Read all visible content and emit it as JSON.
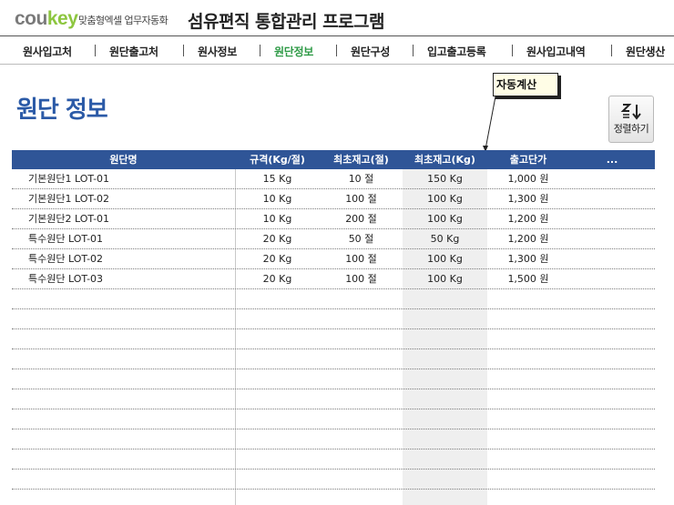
{
  "header": {
    "logo_gray": "cou",
    "logo_green": "key",
    "logo_sub": "맞춤형엑셀 업무자동화",
    "app_title": "섬유편직 통합관리 프로그램"
  },
  "nav": {
    "items": [
      "원사입고처",
      "원단출고처",
      "원사정보",
      "원단정보",
      "원단구성",
      "입고출고등록",
      "원사입고내역",
      "원단생산"
    ],
    "active_index": 3
  },
  "page": {
    "title": "원단 정보",
    "callout": "자동계산",
    "sort_button": "정렬하기"
  },
  "table": {
    "headers": [
      "원단명",
      "규격(Kg/절)",
      "최초재고(절)",
      "최초재고(Kg)",
      "출고단가",
      "..."
    ],
    "rows": [
      {
        "name": "기본원단1 LOT-01",
        "spec": "15 Kg",
        "init_jeol": "10 절",
        "init_kg": "150 Kg",
        "price": "1,000 원"
      },
      {
        "name": "기본원단1 LOT-02",
        "spec": "10 Kg",
        "init_jeol": "100 절",
        "init_kg": "100 Kg",
        "price": "1,300 원"
      },
      {
        "name": "기본원단2 LOT-01",
        "spec": "10 Kg",
        "init_jeol": "200 절",
        "init_kg": "100 Kg",
        "price": "1,200 원"
      },
      {
        "name": "특수원단 LOT-01",
        "spec": "20 Kg",
        "init_jeol": "50 절",
        "init_kg": "50 Kg",
        "price": "1,200 원"
      },
      {
        "name": "특수원단 LOT-02",
        "spec": "20 Kg",
        "init_jeol": "100 절",
        "init_kg": "100 Kg",
        "price": "1,300 원"
      },
      {
        "name": "특수원단 LOT-03",
        "spec": "20 Kg",
        "init_jeol": "100 절",
        "init_kg": "100 Kg",
        "price": "1,500 원"
      },
      {
        "name": "",
        "spec": "",
        "init_jeol": "",
        "init_kg": "",
        "price": ""
      },
      {
        "name": "",
        "spec": "",
        "init_jeol": "",
        "init_kg": "",
        "price": ""
      },
      {
        "name": "",
        "spec": "",
        "init_jeol": "",
        "init_kg": "",
        "price": ""
      },
      {
        "name": "",
        "spec": "",
        "init_jeol": "",
        "init_kg": "",
        "price": ""
      },
      {
        "name": "",
        "spec": "",
        "init_jeol": "",
        "init_kg": "",
        "price": ""
      },
      {
        "name": "",
        "spec": "",
        "init_jeol": "",
        "init_kg": "",
        "price": ""
      },
      {
        "name": "",
        "spec": "",
        "init_jeol": "",
        "init_kg": "",
        "price": ""
      },
      {
        "name": "",
        "spec": "",
        "init_jeol": "",
        "init_kg": "",
        "price": ""
      },
      {
        "name": "",
        "spec": "",
        "init_jeol": "",
        "init_kg": "",
        "price": ""
      },
      {
        "name": "",
        "spec": "",
        "init_jeol": "",
        "init_kg": "",
        "price": ""
      }
    ]
  },
  "colors": {
    "title_blue": "#2b5aa7",
    "header_blue": "#2f5597",
    "nav_active": "#2e9a46",
    "logo_green": "#8dc63f",
    "marker_red": "#e0201b"
  },
  "icons": {
    "sort": "sort-descending-icon"
  }
}
